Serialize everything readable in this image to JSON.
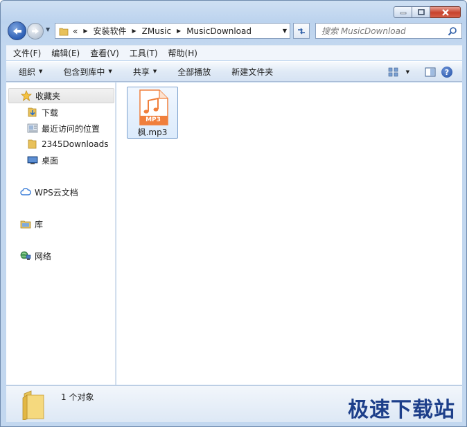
{
  "address": {
    "overflow": "«",
    "crumbs": [
      "安装软件",
      "ZMusic",
      "MusicDownload"
    ]
  },
  "search": {
    "placeholder": "搜索 MusicDownload"
  },
  "menu": [
    "文件(F)",
    "编辑(E)",
    "查看(V)",
    "工具(T)",
    "帮助(H)"
  ],
  "commands": {
    "organize": "组织",
    "include_library": "包含到库中",
    "share": "共享",
    "play_all": "全部播放",
    "new_folder": "新建文件夹"
  },
  "nav": {
    "favorites": "收藏夹",
    "downloads": "下载",
    "recent": "最近访问的位置",
    "downloads2345": "2345Downloads",
    "desktop": "桌面",
    "wps": "WPS云文档",
    "library": "库",
    "network": "网络"
  },
  "files": [
    {
      "name": "枫.mp3",
      "badge": "MP3"
    }
  ],
  "status": {
    "count": "1 个对象"
  },
  "watermark": "极速下载站",
  "colors": {
    "mp3_accent": "#f07f3c",
    "watermark": "#1d3f8a"
  }
}
